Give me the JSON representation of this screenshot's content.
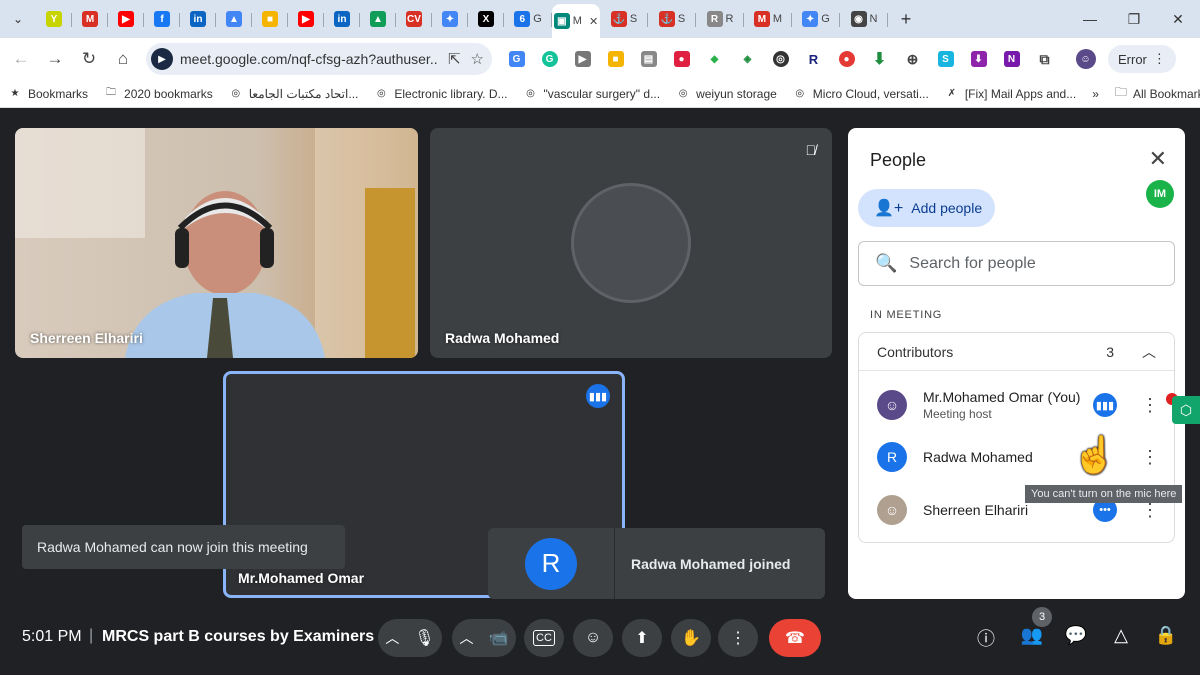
{
  "browser": {
    "tabs": [
      {
        "icon": "Y",
        "color": "#c8d400",
        "label": ""
      },
      {
        "icon": "M",
        "color": "#d93025",
        "label": ""
      },
      {
        "icon": "▶",
        "color": "#ff0000",
        "label": ""
      },
      {
        "icon": "f",
        "color": "#1877f2",
        "label": ""
      },
      {
        "icon": "in",
        "color": "#0a66c2",
        "label": ""
      },
      {
        "icon": "▲",
        "color": "#4285f4",
        "label": ""
      },
      {
        "icon": "■",
        "color": "#f4b400",
        "label": ""
      },
      {
        "icon": "▶",
        "color": "#ff0000",
        "label": ""
      },
      {
        "icon": "in",
        "color": "#0a66c2",
        "label": ""
      },
      {
        "icon": "▲",
        "color": "#0f9d58",
        "label": ""
      },
      {
        "icon": "CV",
        "color": "#d93025",
        "label": ""
      },
      {
        "icon": "✦",
        "color": "#4285f4",
        "label": ""
      },
      {
        "icon": "X",
        "color": "#000000",
        "label": ""
      },
      {
        "icon": "6",
        "color": "#1a73e8",
        "label": "G"
      },
      {
        "icon": "▣",
        "color": "#00897b",
        "label": "M"
      },
      {
        "icon": "⚓",
        "color": "#d93025",
        "label": "S"
      },
      {
        "icon": "⚓",
        "color": "#d93025",
        "label": "S"
      },
      {
        "icon": "R",
        "color": "#888888",
        "label": "R"
      },
      {
        "icon": "M",
        "color": "#d93025",
        "label": "M"
      },
      {
        "icon": "✦",
        "color": "#4285f4",
        "label": "G"
      },
      {
        "icon": "◉",
        "color": "#444444",
        "label": "N"
      }
    ],
    "new_tab": "+",
    "window_controls": {
      "minimize": "—",
      "restore": "❐",
      "close": "✕"
    },
    "url": "meet.google.com/nqf-cfsg-azh?authuser...",
    "error_label": "Error",
    "bookmarks": [
      {
        "icon": "★",
        "label": "Bookmarks"
      },
      {
        "icon": "🗀",
        "label": "2020 bookmarks"
      },
      {
        "icon": "◎",
        "label": "اتحاد مكتبات الجامعا..."
      },
      {
        "icon": "◎",
        "label": "Electronic library. D..."
      },
      {
        "icon": "◎",
        "label": "\"vascular surgery\" d..."
      },
      {
        "icon": "◎",
        "label": "weiyun storage"
      },
      {
        "icon": "◎",
        "label": "Micro Cloud, versati..."
      },
      {
        "icon": "✗",
        "label": "[Fix] Mail Apps and..."
      }
    ],
    "bookmarks_overflow": "»",
    "all_bookmarks": "All Bookmarks"
  },
  "meet": {
    "tiles": {
      "sherreen": "Sherreen Elhariri",
      "radwa": "Radwa Mohamed",
      "mohamed": "Mr.Mohamed Omar"
    },
    "toast_left": "Radwa Mohamed can now join this meeting",
    "toast_join": {
      "avatar_letter": "R",
      "text": "Radwa Mohamed joined"
    },
    "people_panel": {
      "title": "People",
      "add_people": "Add people",
      "search_placeholder": "Search for people",
      "section": "IN MEETING",
      "group": "Contributors",
      "group_count": "3",
      "participants": [
        {
          "name": "Mr.Mohamed Omar (You)",
          "subtitle": "Meeting host",
          "avatar": "",
          "avatar_color": "#5a4a8a"
        },
        {
          "name": "Radwa Mohamed",
          "subtitle": "",
          "avatar": "R",
          "avatar_color": "#1a73e8"
        },
        {
          "name": "Sherreen Elhariri",
          "subtitle": "",
          "avatar": "",
          "avatar_color": "#b0a090"
        }
      ],
      "tooltip": "You can't turn on the mic here",
      "extension_badge": "IM"
    },
    "bottom": {
      "time": "5:01 PM",
      "separator": "|",
      "meeting_title": "MRCS part B courses by Examiners ...",
      "people_count": "3"
    }
  }
}
